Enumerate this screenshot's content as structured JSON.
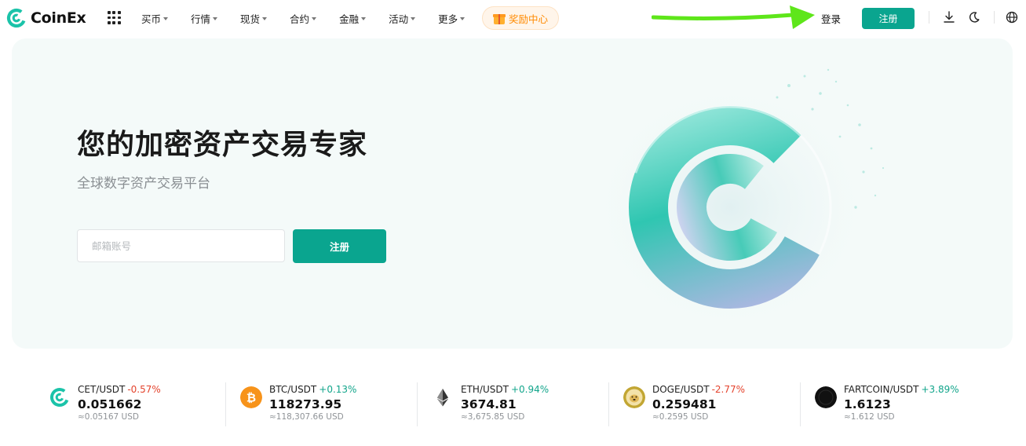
{
  "brand": {
    "name": "CoinEx"
  },
  "nav": {
    "menu": [
      {
        "label": "买币",
        "has_dropdown": true
      },
      {
        "label": "行情",
        "has_dropdown": true
      },
      {
        "label": "现货",
        "has_dropdown": true
      },
      {
        "label": "合约",
        "has_dropdown": true
      },
      {
        "label": "金融",
        "has_dropdown": true
      },
      {
        "label": "活动",
        "has_dropdown": true
      },
      {
        "label": "更多",
        "has_dropdown": true
      }
    ],
    "rewards_label": "奖励中心",
    "login_label": "登录",
    "register_label": "注册",
    "icons": [
      "apps-grid-icon",
      "gift-icon",
      "download-icon",
      "dark-mode-icon",
      "globe-icon"
    ]
  },
  "hero": {
    "headline": "您的加密资产交易专家",
    "subhead": "全球数字资产交易平台",
    "email_placeholder": "邮箱账号",
    "email_value": "",
    "register_label": "注册"
  },
  "ticker": [
    {
      "pair": "CET/USDT",
      "change": "-0.57%",
      "direction": "down",
      "price": "0.051662",
      "usd": "≈0.05167 USD",
      "icon": "cet-coin-icon"
    },
    {
      "pair": "BTC/USDT",
      "change": "+0.13%",
      "direction": "up",
      "price": "118273.95",
      "usd": "≈118,307.66 USD",
      "icon": "btc-coin-icon"
    },
    {
      "pair": "ETH/USDT",
      "change": "+0.94%",
      "direction": "up",
      "price": "3674.81",
      "usd": "≈3,675.85 USD",
      "icon": "eth-coin-icon"
    },
    {
      "pair": "DOGE/USDT",
      "change": "-2.77%",
      "direction": "down",
      "price": "0.259481",
      "usd": "≈0.2595 USD",
      "icon": "doge-coin-icon"
    },
    {
      "pair": "FARTCOIN/USDT",
      "change": "+3.89%",
      "direction": "up",
      "price": "1.6123",
      "usd": "≈1.612 USD",
      "icon": "fartcoin-coin-icon"
    }
  ],
  "colors": {
    "brand_green": "#0aa58f",
    "up": "#12a58b",
    "down": "#e4432d",
    "hero_bg": "#f4faf9",
    "annotation_arrow": "#5ee61a"
  }
}
